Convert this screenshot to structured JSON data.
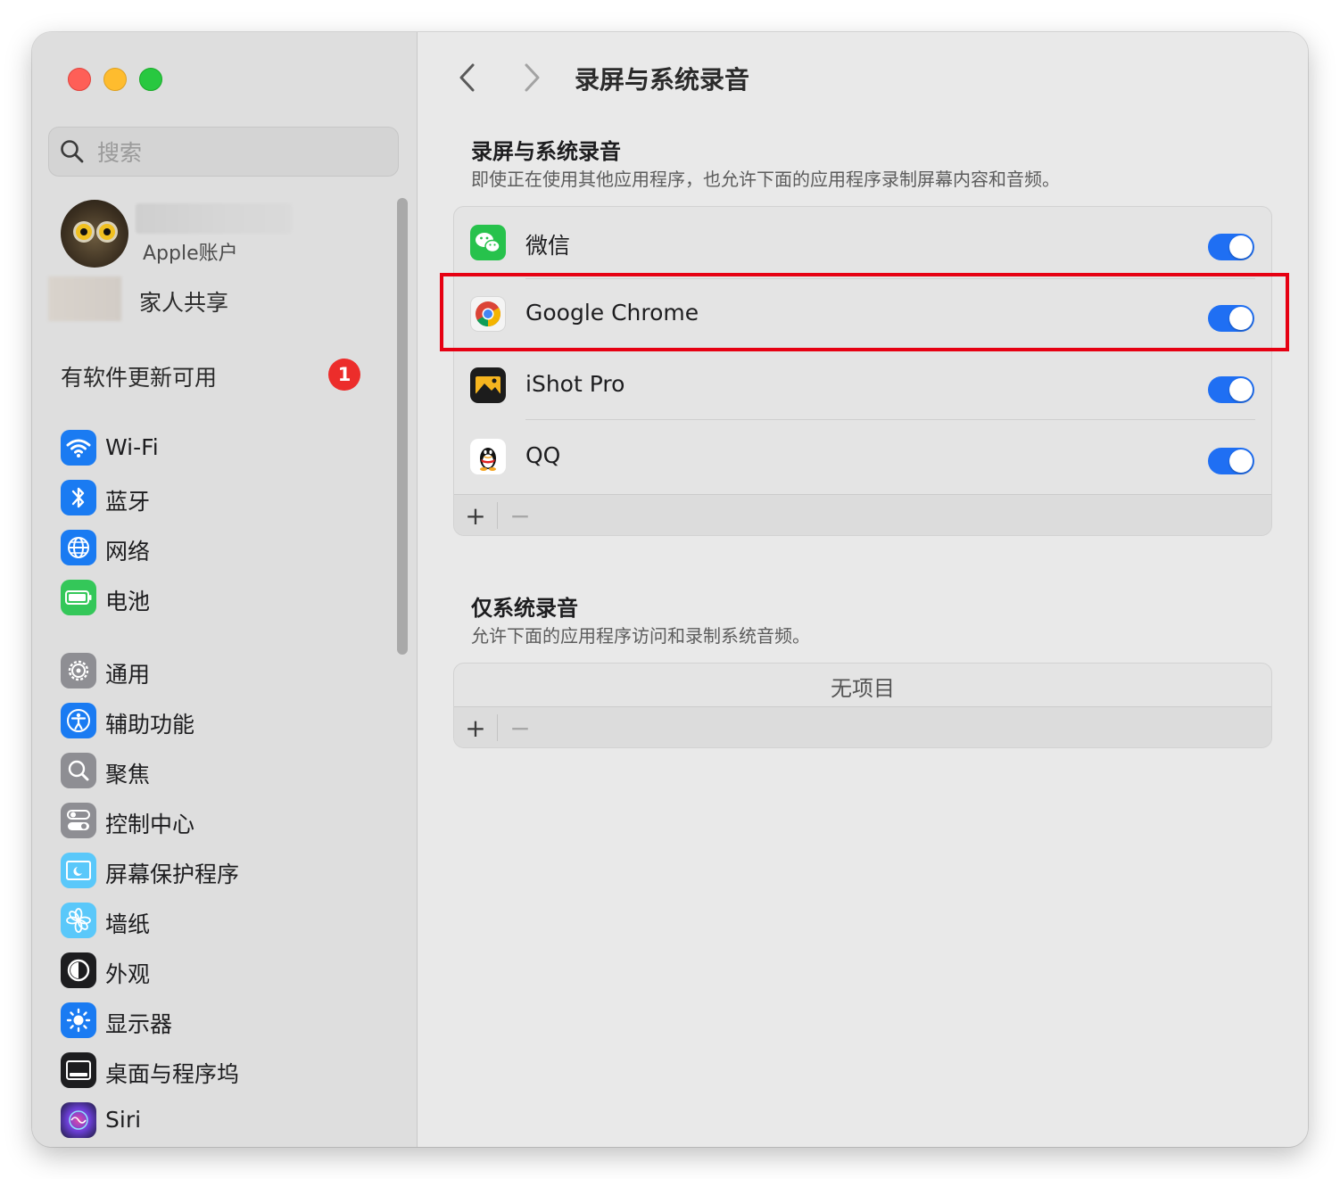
{
  "sidebar": {
    "search_placeholder": "搜索",
    "account": {
      "subtitle": "Apple账户",
      "family": "家人共享"
    },
    "update": {
      "label": "有软件更新可用",
      "badge": "1"
    },
    "items": [
      {
        "label": "Wi-Fi",
        "icon": "wifi-icon",
        "color": "#1a7bf2"
      },
      {
        "label": "蓝牙",
        "icon": "bluetooth-icon",
        "color": "#1a7bf2"
      },
      {
        "label": "网络",
        "icon": "globe-icon",
        "color": "#1a7bf2"
      },
      {
        "label": "电池",
        "icon": "battery-icon",
        "color": "#34c759"
      },
      {
        "label": "通用",
        "icon": "gear-icon",
        "color": "#8e8e93"
      },
      {
        "label": "辅助功能",
        "icon": "accessibility-icon",
        "color": "#1a7bf2"
      },
      {
        "label": "聚焦",
        "icon": "magnifier-icon",
        "color": "#8e8e93"
      },
      {
        "label": "控制中心",
        "icon": "control-center-icon",
        "color": "#8e8e93"
      },
      {
        "label": "屏幕保护程序",
        "icon": "screensaver-icon",
        "color": "#5ac8fa"
      },
      {
        "label": "墙纸",
        "icon": "flower-icon",
        "color": "#5ac8fa"
      },
      {
        "label": "外观",
        "icon": "appearance-icon",
        "color": "#1d1d1f"
      },
      {
        "label": "显示器",
        "icon": "sun-icon",
        "color": "#1a7bf2"
      },
      {
        "label": "桌面与程序坞",
        "icon": "dock-icon",
        "color": "#1d1d1f"
      },
      {
        "label": "Siri",
        "icon": "siri-icon",
        "color": "#6b3fd6"
      }
    ]
  },
  "main": {
    "title": "录屏与系统录音",
    "section1": {
      "title": "录屏与系统录音",
      "desc": "即使正在使用其他应用程序，也允许下面的应用程序录制屏幕内容和音频。",
      "apps": [
        {
          "name": "微信",
          "enabled": true,
          "icon": "wechat-icon"
        },
        {
          "name": "Google Chrome",
          "enabled": true,
          "icon": "chrome-icon"
        },
        {
          "name": "iShot Pro",
          "enabled": true,
          "icon": "ishot-icon"
        },
        {
          "name": "QQ",
          "enabled": true,
          "icon": "qq-icon"
        }
      ]
    },
    "section2": {
      "title": "仅系统录音",
      "desc": "允许下面的应用程序访问和录制系统音频。",
      "empty": "无项目"
    },
    "footer": {
      "add": "+",
      "remove": "−"
    }
  },
  "colors": {
    "accent": "#1f6ff3",
    "highlight": "#e60012",
    "badge": "#ec2d2b"
  }
}
